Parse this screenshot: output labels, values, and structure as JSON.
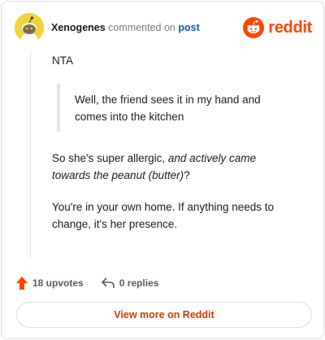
{
  "header": {
    "username": "Xenogenes",
    "commented_on_text": "commented on",
    "post_link": "post",
    "brand": "reddit"
  },
  "comment": {
    "verdict": "NTA",
    "quote": "Well, the friend sees it in my hand and comes into the kitchen",
    "p2_plain": "So she's super allergic, ",
    "p2_italic": "and actively came towards the peanut (butter)",
    "p2_end": "?",
    "p3": "You're in your own home. If anything needs to change, it's her presence."
  },
  "footer": {
    "upvotes": "18 upvotes",
    "replies": "0 replies"
  },
  "cta": {
    "label": "View more on Reddit"
  },
  "colors": {
    "accent": "#ff4500",
    "link": "#0a5bbd",
    "cta_text": "#d93a00",
    "avatar_bg": "#f0d23c"
  },
  "icons": [
    "snoo-avatar-icon",
    "reddit-logo-icon",
    "upvote-arrow-icon",
    "reply-arrow-icon"
  ]
}
